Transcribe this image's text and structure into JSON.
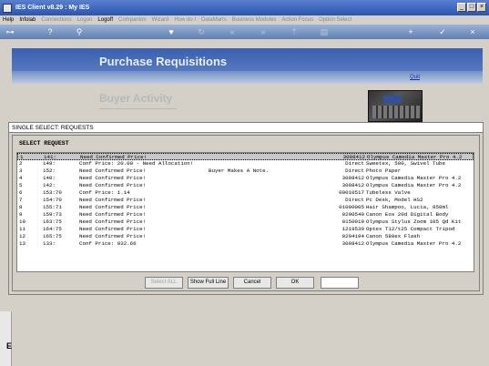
{
  "window": {
    "title": "IES Client v8.29 : My IES"
  },
  "menubar": [
    {
      "label": "Help",
      "enabled": true
    },
    {
      "label": "Infolab",
      "enabled": true
    },
    {
      "label": "Connections",
      "enabled": false
    },
    {
      "label": "Logon",
      "enabled": false
    },
    {
      "label": "Logoff",
      "enabled": true
    },
    {
      "label": "Companion",
      "enabled": false
    },
    {
      "label": "Wizard",
      "enabled": false
    },
    {
      "label": "How do I",
      "enabled": false
    },
    {
      "label": "DataMarts",
      "enabled": false
    },
    {
      "label": "Business Modules",
      "enabled": false
    },
    {
      "label": "Action Focus",
      "enabled": false
    },
    {
      "label": "Option Select",
      "enabled": false
    }
  ],
  "toolbar_icons": [
    "key-icon",
    "help-icon",
    "search-icon",
    "heart-icon",
    "refresh-icon",
    "rewind-icon",
    "forward-icon",
    "upload-icon",
    "document-icon",
    "add-icon",
    "check-icon",
    "close-icon"
  ],
  "banner": {
    "title": "Purchase Requisitions",
    "quit": "Quit",
    "subtitle": "Buyer Activity"
  },
  "dialog": {
    "title": "SINGLE SELECT: REQUESTS",
    "heading": "SELECT REQUEST",
    "rows": [
      {
        "num": "1",
        "ref": "141:",
        "msg": "Need Confirmed Price!",
        "note": "",
        "code": "3008412",
        "desc": "Olympus Camedia Master Pro 4.2"
      },
      {
        "num": "2",
        "ref": "149:",
        "msg": "Conf Price: 20.00 - Need Allocation!",
        "note": "",
        "code": "Direct",
        "desc": "Sweetex, 500, Swivel Tube"
      },
      {
        "num": "3",
        "ref": "152:",
        "msg": "Need Confirmed Price!",
        "note": "Buyer Makes A Note.",
        "code": "Direct",
        "desc": "Photo Paper"
      },
      {
        "num": "4",
        "ref": "140:",
        "msg": "Need Confirmed Price!",
        "note": "",
        "code": "3008412",
        "desc": "Olympus Camedia Master Pro 4.2"
      },
      {
        "num": "5",
        "ref": "142:",
        "msg": "Need Confirmed Price!",
        "note": "",
        "code": "3008412",
        "desc": "Olympus Camedia Master Pro 4.2"
      },
      {
        "num": "6",
        "ref": "153:70",
        "msg": "Conf Price: 1.14",
        "note": "",
        "code": "00010517",
        "desc": "Tubeless Valve"
      },
      {
        "num": "7",
        "ref": "154:70",
        "msg": "Need Confirmed Price!",
        "note": "",
        "code": "Direct",
        "desc": "Pc Desk, Model HS2"
      },
      {
        "num": "8",
        "ref": "155:71",
        "msg": "Need Confirmed Price!",
        "note": "",
        "code": "01000005",
        "desc": "Hair Shampoo, Lucia, 850ml"
      },
      {
        "num": "9",
        "ref": "159:73",
        "msg": "Need Confirmed Price!",
        "note": "",
        "code": "0200540",
        "desc": "Canon Eos 20d Digital Body"
      },
      {
        "num": "10",
        "ref": "163:75",
        "msg": "Need Confirmed Price!",
        "note": "",
        "code": "0150019",
        "desc": "Olympus Stylus Zoom 105 Qd Kit"
      },
      {
        "num": "11",
        "ref": "164:75",
        "msg": "Need Confirmed Price!",
        "note": "",
        "code": "1219530",
        "desc": "Optex T12/t25 Compact Tripod"
      },
      {
        "num": "12",
        "ref": "165:75",
        "msg": "Need Confirmed Price!",
        "note": "",
        "code": "0204194",
        "desc": "Canon 580ex Flash"
      },
      {
        "num": "13",
        "ref": "133:",
        "msg": "Conf Price: 932.66",
        "note": "",
        "code": "3008412",
        "desc": "Olympus Camedia Master Pro 4.2"
      }
    ],
    "buttons": {
      "select_all": "Select ALL",
      "show_full_line": "Show Full Line",
      "cancel": "Cancel",
      "ok": "OK"
    },
    "ok_field_value": ""
  },
  "left_edge_label": "E"
}
